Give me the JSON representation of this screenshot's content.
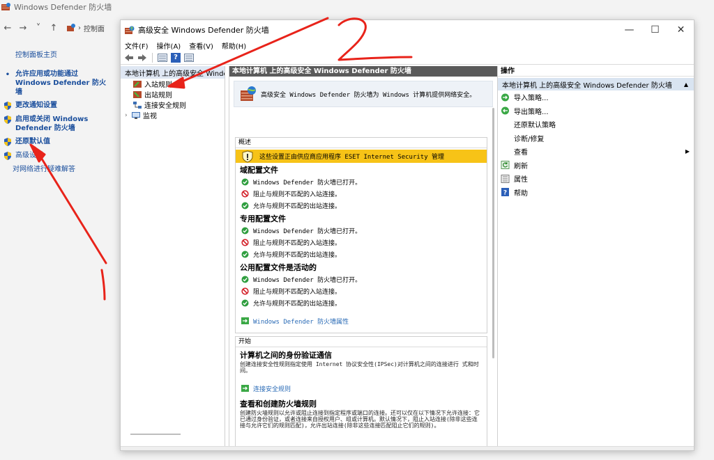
{
  "background": {
    "title": "Windows Defender 防火墙",
    "nav": {
      "back": "←",
      "forward": "→",
      "recent": "˅",
      "up": "↑",
      "breadcrumb": "控制面"
    },
    "sidebar": {
      "home": "控制面板主页",
      "items": [
        {
          "label": "允许应用或功能通过 Windows Defender 防火墙",
          "bold": true
        },
        {
          "label": "更改通知设置",
          "bold": true
        },
        {
          "label": "启用或关闭 Windows Defender 防火墙",
          "bold": true
        },
        {
          "label": "还原默认值",
          "bold": true
        },
        {
          "label": "高级设置",
          "bold": false
        },
        {
          "label": "对网络进行疑难解答",
          "bold": false
        }
      ]
    }
  },
  "window": {
    "title": "高级安全 Windows Defender 防火墙",
    "controls": {
      "minimize": "—",
      "maximize": "☐",
      "close": "✕"
    },
    "menu": [
      "文件(F)",
      "操作(A)",
      "查看(V)",
      "帮助(H)"
    ],
    "tree": {
      "root": "本地计算机 上的高级安全 Windows",
      "nodes": [
        "入站规则",
        "出站规则",
        "连接安全规则",
        "监视"
      ]
    },
    "center": {
      "header": "本地计算机 上的高级安全 Windows Defender 防火墙",
      "banner": "高级安全 Windows Defender 防火墙为 Windows 计算机提供网络安全。",
      "overview": {
        "header": "概述",
        "warning": "这些设置正由供应商应用程序 ESET Internet Security 管理",
        "profiles": [
          {
            "title": "域配置文件",
            "rows": [
              "Windows Defender 防火墙已打开。",
              "阻止与规则不匹配的入站连接。",
              "允许与规则不匹配的出站连接。"
            ]
          },
          {
            "title": "专用配置文件",
            "rows": [
              "Windows Defender 防火墙已打开。",
              "阻止与规则不匹配的入站连接。",
              "允许与规则不匹配的出站连接。"
            ]
          },
          {
            "title": "公用配置文件是活动的",
            "rows": [
              "Windows Defender 防火墙已打开。",
              "阻止与规则不匹配的入站连接。",
              "允许与规则不匹配的出站连接。"
            ]
          }
        ],
        "properties_link": "Windows Defender 防火墙属性"
      },
      "start": {
        "header": "开始",
        "auth_title": "计算机之间的身份验证通信",
        "auth_text": "创建连接安全性规则指定使用 Internet 协议安全性(IPSec)对计算机之间的连接进行 式和时间。",
        "auth_link": "连接安全规则",
        "rules_title": "查看和创建防火墙规则",
        "rules_text": "创建防火墙规则以允许或阻止连接到指定程序或端口的连接。还可以仅在以下情况下允许连接：它已通过身份验证，或者连接来自授权用户、组或计算机。默认情况下，阻止入站连接(除非这些连接与允许它们的规则匹配)，允许出站连接(除非这些连接匹配阻止它们的规则)。"
      }
    },
    "actions": {
      "header": "操作",
      "selected": "本地计算机 上的高级安全 Windows Defender 防火墙",
      "items": [
        "导入策略...",
        "导出策略...",
        "还原默认策略",
        "诊断/修复",
        "查看",
        "刷新",
        "属性",
        "帮助"
      ]
    }
  },
  "colors": {
    "accent": "#2a6bb6",
    "warning": "#f7c317",
    "annotation": "#e8231a"
  }
}
